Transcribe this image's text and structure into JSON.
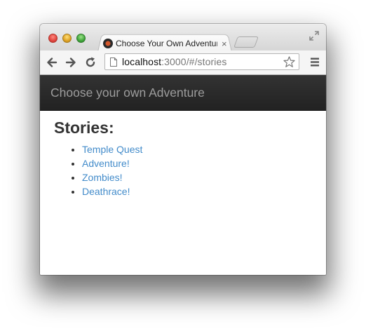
{
  "browser": {
    "tab_title": "Choose Your Own Adventure",
    "tab_close": "×",
    "url_host": "localhost",
    "url_path": ":3000/#/stories"
  },
  "page": {
    "brand": "Choose your own Adventure",
    "heading": "Stories:",
    "stories": [
      {
        "title": "Temple Quest"
      },
      {
        "title": "Adventure!"
      },
      {
        "title": "Zombies!"
      },
      {
        "title": "Deathrace!"
      }
    ]
  },
  "colors": {
    "link": "#428bca",
    "navbar": "#222222",
    "brand_text": "#9d9d9d"
  }
}
